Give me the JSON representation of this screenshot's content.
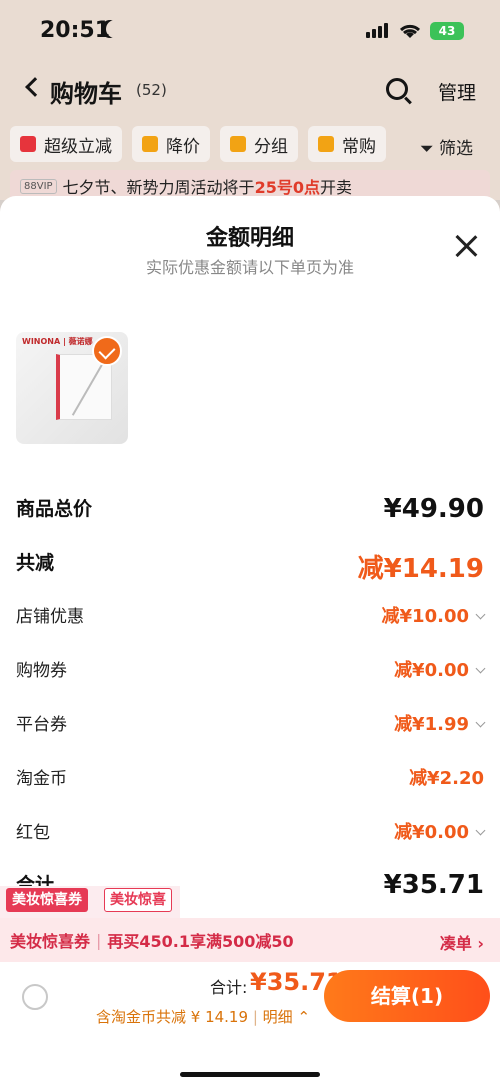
{
  "status": {
    "time": "20:51",
    "battery": "43"
  },
  "nav": {
    "title": "购物车",
    "count": "(52)",
    "manage": "管理"
  },
  "filters": [
    {
      "label": "超级立减",
      "color": "#e6343c"
    },
    {
      "label": "降价",
      "color": "#f2a314"
    },
    {
      "label": "分组",
      "color": "#f2a314"
    },
    {
      "label": "常购",
      "color": "#f2a314"
    }
  ],
  "filter_btn": "筛选",
  "notice": {
    "vip": "88VIP",
    "text_before": "七夕节、新势力周活动将于",
    "highlight": "25号0点",
    "text_after": "开卖"
  },
  "sheet": {
    "title": "金额明细",
    "subtitle": "实际优惠金额请以下单页为准",
    "product_brand": "WINONA | 薇诺娜"
  },
  "rows": [
    {
      "label": "商品总价",
      "value": "¥49.90",
      "big": true
    },
    {
      "label": "共减",
      "value": "减¥14.19",
      "big": true
    },
    {
      "label": "店铺优惠",
      "value": "减¥10.00"
    },
    {
      "label": "购物券",
      "value": "减¥0.00"
    },
    {
      "label": "平台券",
      "value": "减¥1.99"
    },
    {
      "label": "淘金币",
      "value": "减¥2.20"
    },
    {
      "label": "红包",
      "value": "减¥0.00"
    },
    {
      "label": "合计",
      "value": "¥35.71"
    }
  ],
  "coupons": {
    "tag1": "美妆惊喜券",
    "tag2": "美妆惊喜"
  },
  "promo": {
    "name": "美妆惊喜券",
    "text": "再买450.1享满500减50",
    "action": "凑单"
  },
  "footer": {
    "total_label": "合计:",
    "total_value": "¥35.71",
    "saving_text": "含淘金币共减 ¥ 14.19",
    "detail": "明细",
    "checkout": "结算(1)"
  }
}
